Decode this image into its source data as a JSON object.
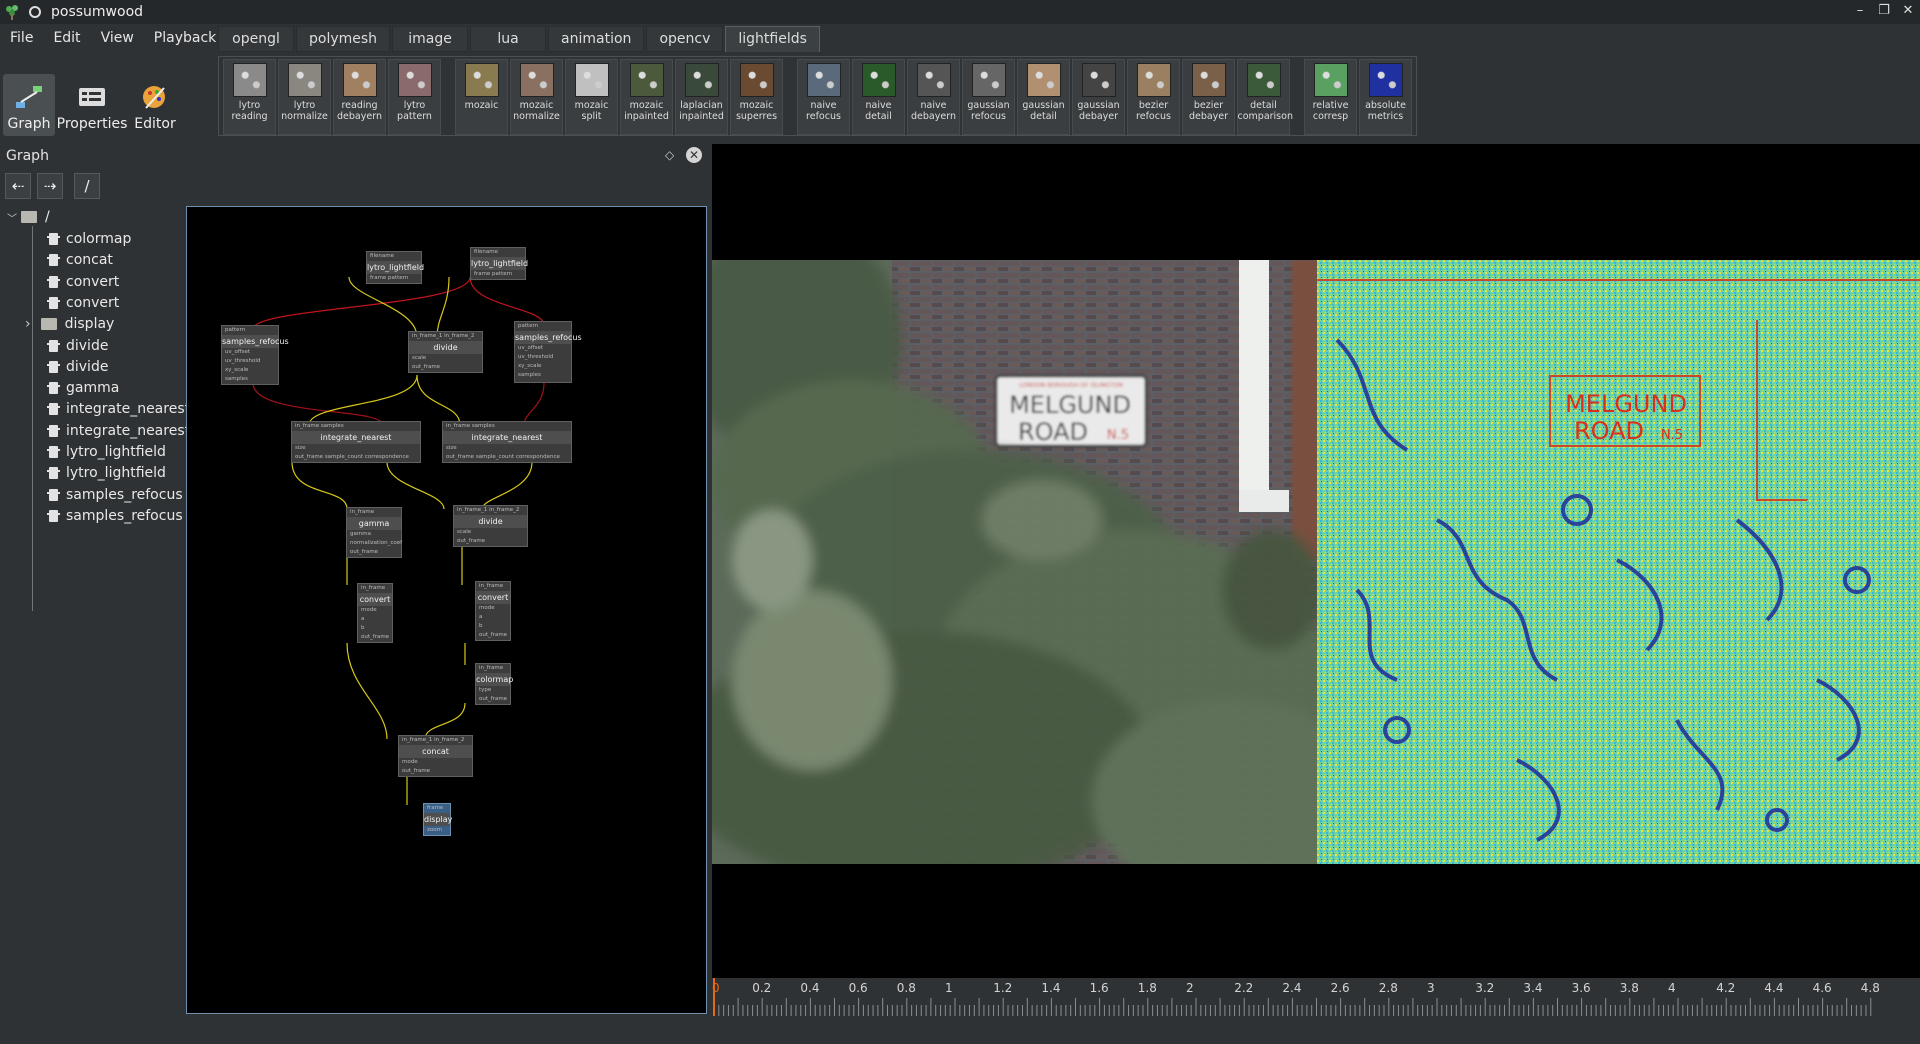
{
  "window": {
    "title": "possumwood",
    "controls": [
      "–",
      "❐",
      "✕"
    ]
  },
  "menu": [
    "File",
    "Edit",
    "View",
    "Playback"
  ],
  "tabs": [
    {
      "label": "opengl",
      "active": false
    },
    {
      "label": "polymesh",
      "active": false
    },
    {
      "label": "image",
      "active": false
    },
    {
      "label": "lua",
      "active": false
    },
    {
      "label": "animation",
      "active": false
    },
    {
      "label": "opencv",
      "active": false
    },
    {
      "label": "lightfields",
      "active": true
    }
  ],
  "sidebar_buttons": [
    {
      "label": "Graph",
      "icon": "graph-icon",
      "active": true
    },
    {
      "label": "Properties",
      "icon": "properties-icon",
      "active": false
    },
    {
      "label": "Editor",
      "icon": "editor-icon",
      "active": false
    }
  ],
  "toolbar": [
    {
      "label": "lytro reading",
      "color": "#8a8a8a",
      "group": 1
    },
    {
      "label": "lytro normalize",
      "color": "#8a8680",
      "group": 1
    },
    {
      "label": "reading debayern",
      "color": "#a08060",
      "group": 1
    },
    {
      "label": "lytro pattern",
      "color": "#8a6a6a",
      "group": 1
    },
    {
      "label": "mozaic",
      "color": "#8a7a50",
      "group": 2
    },
    {
      "label": "mozaic normalize",
      "color": "#8a7060",
      "group": 2
    },
    {
      "label": "mozaic split",
      "color": "#c0c0c0",
      "group": 2
    },
    {
      "label": "mozaic inpainted",
      "color": "#4a5a3a",
      "group": 2
    },
    {
      "label": "laplacian inpainted",
      "color": "#3a4a3a",
      "group": 2
    },
    {
      "label": "mozaic superres",
      "color": "#6a4a30",
      "group": 2
    },
    {
      "label": "naive refocus",
      "color": "#5a6a7a",
      "group": 3
    },
    {
      "label": "naive detail",
      "color": "#2a5a2a",
      "group": 3
    },
    {
      "label": "naive debayern",
      "color": "#555",
      "group": 3
    },
    {
      "label": "gaussian refocus",
      "color": "#666",
      "group": 3
    },
    {
      "label": "gaussian detail",
      "color": "#b09070",
      "group": 3
    },
    {
      "label": "gaussian debayer",
      "color": "#444",
      "group": 3
    },
    {
      "label": "bezier refocus",
      "color": "#9a8060",
      "group": 3
    },
    {
      "label": "bezier debayer",
      "color": "#7a6048",
      "group": 3
    },
    {
      "label": "detail comparison",
      "color": "#3a5a3a",
      "group": 3
    },
    {
      "label": "relative corresp",
      "color": "#5aa060",
      "group": 4
    },
    {
      "label": "absolute metrics",
      "color": "#2030a0",
      "group": 4
    }
  ],
  "panel": {
    "title": "Graph",
    "float_icon": "◇",
    "close_icon": "✕",
    "path": "/"
  },
  "tree": {
    "root": "/",
    "items": [
      {
        "label": "colormap",
        "type": "node"
      },
      {
        "label": "concat",
        "type": "node"
      },
      {
        "label": "convert",
        "type": "node"
      },
      {
        "label": "convert",
        "type": "node"
      },
      {
        "label": "display",
        "type": "folder"
      },
      {
        "label": "divide",
        "type": "node"
      },
      {
        "label": "divide",
        "type": "node"
      },
      {
        "label": "gamma",
        "type": "node"
      },
      {
        "label": "integrate_nearest",
        "type": "node"
      },
      {
        "label": "integrate_nearest",
        "type": "node"
      },
      {
        "label": "lytro_lightfield",
        "type": "node"
      },
      {
        "label": "lytro_lightfield",
        "type": "node"
      },
      {
        "label": "samples_refocus",
        "type": "node"
      },
      {
        "label": "samples_refocus",
        "type": "node"
      }
    ]
  },
  "graph_nodes": {
    "lytro1": {
      "title": "lytro_lightfield",
      "ports": [
        "filename",
        "frame   pattern"
      ]
    },
    "lytro2": {
      "title": "lytro_lightfield",
      "ports": [
        "filename",
        "frame   pattern"
      ]
    },
    "refocus1": {
      "title": "samples_refocus",
      "ports": [
        "pattern",
        "uv_offset",
        "uv_threshold",
        "xy_scale",
        "samples"
      ]
    },
    "divide1": {
      "title": "divide",
      "ports": [
        "in_frame_1   in_frame_2",
        "scale",
        "out_frame"
      ]
    },
    "refocus2": {
      "title": "samples_refocus",
      "ports": [
        "pattern",
        "uv_offset",
        "uv_threshold",
        "xy_scale",
        "samples"
      ]
    },
    "integ1": {
      "title": "integrate_nearest",
      "ports": [
        "in_frame   samples",
        "size",
        "out_frame   sample_count   correspondence"
      ]
    },
    "integ2": {
      "title": "integrate_nearest",
      "ports": [
        "in_frame   samples",
        "size",
        "out_frame   sample_count   correspondence"
      ]
    },
    "gamma": {
      "title": "gamma",
      "ports": [
        "in_frame",
        "gamma",
        "normalization_coef",
        "out_frame"
      ]
    },
    "divide2": {
      "title": "divide",
      "ports": [
        "in_frame_1   in_frame_2",
        "scale",
        "out_frame"
      ]
    },
    "convert1": {
      "title": "convert",
      "ports": [
        "in_frame",
        "mode",
        "a",
        "b",
        "out_frame"
      ]
    },
    "convert2": {
      "title": "convert",
      "ports": [
        "in_frame",
        "mode",
        "a",
        "b",
        "out_frame"
      ]
    },
    "colormap": {
      "title": "colormap",
      "ports": [
        "in_frame",
        "type",
        "out_frame"
      ]
    },
    "concat": {
      "title": "concat",
      "ports": [
        "in_frame_1   in_frame_2",
        "mode",
        "out_frame"
      ]
    },
    "display": {
      "title": "display",
      "ports": [
        "frame",
        "zoom"
      ]
    }
  },
  "viewer": {
    "sign_top": "LONDON BOROUGH OF ISLINGTON",
    "sign_line1": "MELGUND",
    "sign_line2": "ROAD",
    "sign_suffix": "N.5"
  },
  "timeline": {
    "ticks": [
      "0",
      "0.2",
      "0.4",
      "0.6",
      "0.8",
      "1",
      "1.2",
      "1.4",
      "1.6",
      "1.8",
      "2",
      "2.2",
      "2.4",
      "2.6",
      "2.8",
      "3",
      "3.2",
      "3.4",
      "3.6",
      "3.8",
      "4",
      "4.2",
      "4.4",
      "4.6",
      "4.8"
    ]
  }
}
